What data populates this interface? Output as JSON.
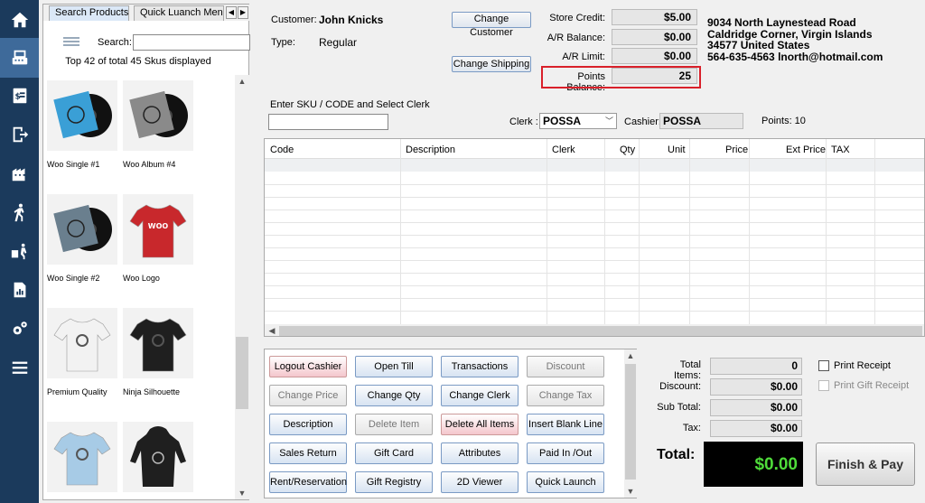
{
  "nav": {
    "icons": [
      "home-icon",
      "pos-register-icon",
      "receipt-icon",
      "exit-icon",
      "building-icon",
      "walking-person-icon",
      "delivery-icon",
      "report-chart-icon",
      "settings-icon",
      "menu-icon"
    ]
  },
  "products_panel": {
    "tabs": [
      "Search Products",
      "Quick Luanch Menus"
    ],
    "search_label": "Search:",
    "search_value": "",
    "sku_count": "Top 42 of total 45 Skus displayed",
    "items": [
      {
        "name": "Woo Single #1",
        "kind": "vinyl",
        "color": "#3a9fd6"
      },
      {
        "name": "Woo Album #4",
        "kind": "vinyl",
        "color": "#8a8a8a"
      },
      {
        "name": "Woo Single #2",
        "kind": "vinyl",
        "color": "#6a7f8e"
      },
      {
        "name": "Woo Logo",
        "kind": "tshirt",
        "color": "#c8282c",
        "logo": "WOO"
      },
      {
        "name": "Premium Quality",
        "kind": "tshirt",
        "color": "#f2f2f2"
      },
      {
        "name": "Ninja Silhouette",
        "kind": "tshirt",
        "color": "#1f1f1f"
      },
      {
        "name": "",
        "kind": "tshirt",
        "color": "#a7cbe6"
      },
      {
        "name": "",
        "kind": "hoodie",
        "color": "#1f1f1f"
      }
    ]
  },
  "customer": {
    "customer_label": "Customer:",
    "customer_name": "John Knicks",
    "type_label": "Type:",
    "type_value": "Regular",
    "change_customer": "Change Customer",
    "change_shipping": "Change Shipping"
  },
  "balances": {
    "store_credit_label": "Store Credit:",
    "store_credit": "$5.00",
    "ar_balance_label": "A/R Balance:",
    "ar_balance": "$0.00",
    "ar_limit_label": "A/R Limit:",
    "ar_limit": "$0.00",
    "points_balance_label": "Points Balance:",
    "points_balance": "25"
  },
  "address": {
    "line1": "9034 North Laynestead Road",
    "line2": "Caldridge Corner, Virgin Islands",
    "line3": "34577 United States",
    "line4": "564-635-4563 lnorth@hotmail.com"
  },
  "entry": {
    "sku_label": "Enter SKU / CODE and Select Clerk",
    "sku_value": "",
    "clerk_label": "Clerk :",
    "clerk_value": "POSSA",
    "cashier_label": "Cashier:",
    "cashier_value": "POSSA",
    "points_text": "Points: 10"
  },
  "grid": {
    "columns": [
      "Code",
      "Description",
      "Clerk",
      "Qty",
      "Unit",
      "Price",
      "Ext Price",
      "TAX"
    ]
  },
  "actions": [
    {
      "label": "Logout Cashier",
      "style": "red"
    },
    {
      "label": "Open Till",
      "style": "normal"
    },
    {
      "label": "Transactions",
      "style": "normal"
    },
    {
      "label": "Discount",
      "style": "disabled"
    },
    {
      "label": "Change Price",
      "style": "disabled"
    },
    {
      "label": "Change Qty",
      "style": "normal"
    },
    {
      "label": "Change Clerk",
      "style": "normal"
    },
    {
      "label": "Change Tax",
      "style": "disabled"
    },
    {
      "label": "Description",
      "style": "normal"
    },
    {
      "label": "Delete Item",
      "style": "disabled"
    },
    {
      "label": "Delete All Items",
      "style": "red"
    },
    {
      "label": "Insert Blank Line",
      "style": "normal"
    },
    {
      "label": "Sales Return",
      "style": "normal"
    },
    {
      "label": "Gift Card",
      "style": "normal"
    },
    {
      "label": "Attributes",
      "style": "normal"
    },
    {
      "label": "Paid In /Out",
      "style": "normal"
    },
    {
      "label": "Rent/Reservation",
      "style": "normal"
    },
    {
      "label": "Gift Registry",
      "style": "normal"
    },
    {
      "label": "2D Viewer",
      "style": "normal"
    },
    {
      "label": "Quick Launch",
      "style": "normal"
    }
  ],
  "totals": {
    "total_items_label": "Total Items:",
    "total_items": "0",
    "discount_label": "Discount:",
    "discount": "$0.00",
    "subtotal_label": "Sub Total:",
    "subtotal": "$0.00",
    "tax_label": "Tax:",
    "tax": "$0.00",
    "total_label": "Total:",
    "total": "$0.00",
    "finish_pay": "Finish & Pay",
    "print_receipt": "Print Receipt",
    "print_receipt_checked": false,
    "print_gift_receipt": "Print Gift Receipt",
    "print_gift_receipt_enabled": false
  },
  "colors": {
    "nav_bg": "#1b3a5c",
    "highlight": "#d9202a",
    "total_text": "#4fdc3a"
  }
}
